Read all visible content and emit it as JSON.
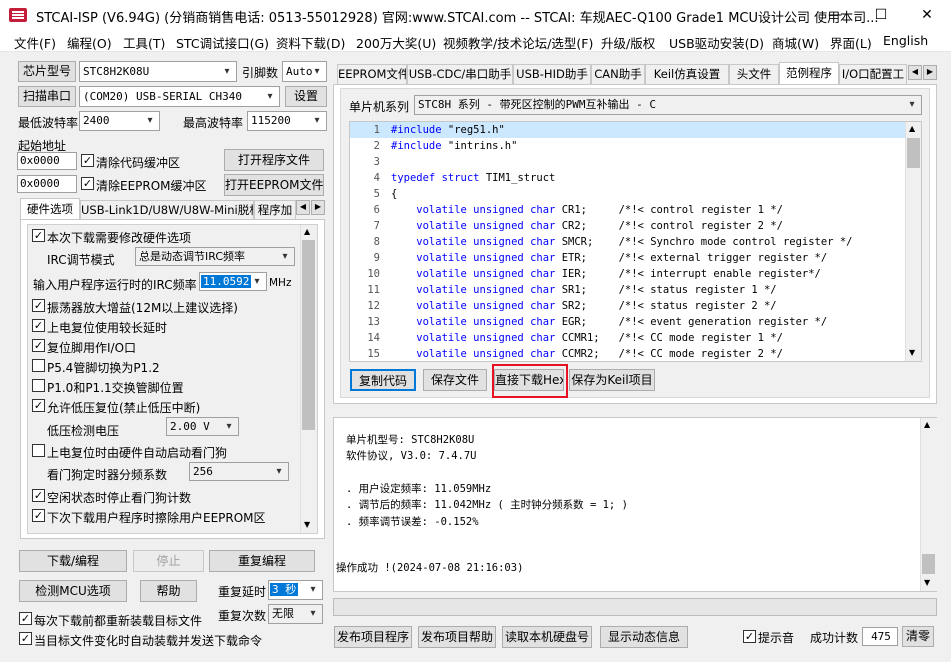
{
  "window": {
    "title": "STCAI-ISP (V6.94G) (分销商销售电话: 0513-55012928) 官网:www.STCAI.com  -- STCAI: 车规AEC-Q100 Grade1 MCU设计公司 使用本司...",
    "minimize": "—",
    "maximize": "☐",
    "close": "✕"
  },
  "menu": [
    "文件(F)",
    "编程(O)",
    "工具(T)",
    "STC调试接口(G)",
    "资料下载(D)",
    "200万大奖(U)",
    "视频教学/技术论坛/选型(F)",
    "升级/版权",
    "USB驱动安装(D)",
    "商城(W)",
    "界面(L)",
    "English"
  ],
  "left": {
    "chip_model_btn": "芯片型号",
    "chip_model": "STC8H2K08U",
    "pin_count_label": "引脚数",
    "pin_count": "Auto",
    "scan_port_btn": "扫描串口",
    "port": "(COM20) USB-SERIAL CH340",
    "settings_btn": "设置",
    "min_baud_label": "最低波特率",
    "min_baud": "2400",
    "max_baud_label": "最高波特率",
    "max_baud": "115200",
    "start_addr_label": "起始地址",
    "addr1": "0x0000",
    "clear_code_buffer": "清除代码缓冲区",
    "open_program_btn": "打开程序文件",
    "addr2": "0x0000",
    "clear_eeprom_buffer": "清除EEPROM缓冲区",
    "open_eeprom_btn": "打开EEPROM文件",
    "tabs": [
      "硬件选项",
      "USB-Link1D/U8W/U8W-Mini脱机",
      "程序加"
    ],
    "options": {
      "hw_change": "本次下载需要修改硬件选项",
      "irc_mode_label": "IRC调节模式",
      "irc_mode": "总是动态调节IRC频率",
      "irc_freq_label": "输入用户程序运行时的IRC频率",
      "irc_freq": "11.0592",
      "irc_unit": "MHz",
      "osc_gain": "振荡器放大增益(12M以上建议选择)",
      "por_delay": "上电复位使用较长延时",
      "reset_io": "复位脚用作I/O口",
      "p54_switch": "P5.4管脚切换为P1.2",
      "p10_swap": "P1.0和P1.1交换管脚位置",
      "lvr": "允许低压复位(禁止低压中断)",
      "lvd_label": "低压检测电压",
      "lvd_value": "2.00 V",
      "wdt_auto": "上电复位时由硬件自动启动看门狗",
      "wdt_prescale_label": "看门狗定时器分频系数",
      "wdt_prescale": "256",
      "wdt_idle": "空闲状态时停止看门狗计数",
      "erase_eeprom": "下次下载用户程序时擦除用户EEPROM区"
    },
    "download_btn": "下载/编程",
    "stop_btn": "停止",
    "reprogram_btn": "重复编程",
    "check_mcu_btn": "检测MCU选项",
    "help_btn": "帮助",
    "repeat_delay_label": "重复延时",
    "repeat_delay": "3 秒",
    "repeat_count_label": "重复次数",
    "repeat_count": "无限",
    "reload_before_download": "每次下载前都重新装载目标文件",
    "auto_load_on_change": "当目标文件变化时自动装载并发送下载命令"
  },
  "right": {
    "tabs": [
      "EEPROM文件",
      "USB-CDC/串口助手",
      "USB-HID助手",
      "CAN助手",
      "Keil仿真设置",
      "头文件",
      "范例程序",
      "I/O口配置工"
    ],
    "active_tab_index": 6,
    "mcu_series_label": "单片机系列",
    "mcu_series": "STC8H 系列 - 带死区控制的PWM互补输出 - C",
    "code_lines": [
      {
        "n": "1",
        "parts": [
          [
            "kw",
            "#include"
          ],
          [
            "str",
            " \"reg51.h\""
          ]
        ]
      },
      {
        "n": "2",
        "parts": [
          [
            "kw",
            "#include"
          ],
          [
            "str",
            " \"intrins.h\""
          ]
        ]
      },
      {
        "n": "3",
        "parts": []
      },
      {
        "n": "4",
        "parts": [
          [
            "kw",
            "typedef struct"
          ],
          [
            "str",
            " TIM1_struct"
          ]
        ]
      },
      {
        "n": "5",
        "parts": [
          [
            "str",
            "{"
          ]
        ]
      },
      {
        "n": "6",
        "parts": [
          [
            "kw",
            "    volatile unsigned char"
          ],
          [
            "str",
            " CR1;     "
          ],
          [
            "cm",
            "/*!< control register 1 */"
          ]
        ]
      },
      {
        "n": "7",
        "parts": [
          [
            "kw",
            "    volatile unsigned char"
          ],
          [
            "str",
            " CR2;     "
          ],
          [
            "cm",
            "/*!< control register 2 */"
          ]
        ]
      },
      {
        "n": "8",
        "parts": [
          [
            "kw",
            "    volatile unsigned char"
          ],
          [
            "str",
            " SMCR;    "
          ],
          [
            "cm",
            "/*!< Synchro mode control register */"
          ]
        ]
      },
      {
        "n": "9",
        "parts": [
          [
            "kw",
            "    volatile unsigned char"
          ],
          [
            "str",
            " ETR;     "
          ],
          [
            "cm",
            "/*!< external trigger register */"
          ]
        ]
      },
      {
        "n": "10",
        "parts": [
          [
            "kw",
            "    volatile unsigned char"
          ],
          [
            "str",
            " IER;     "
          ],
          [
            "cm",
            "/*!< interrupt enable register*/"
          ]
        ]
      },
      {
        "n": "11",
        "parts": [
          [
            "kw",
            "    volatile unsigned char"
          ],
          [
            "str",
            " SR1;     "
          ],
          [
            "cm",
            "/*!< status register 1 */"
          ]
        ]
      },
      {
        "n": "12",
        "parts": [
          [
            "kw",
            "    volatile unsigned char"
          ],
          [
            "str",
            " SR2;     "
          ],
          [
            "cm",
            "/*!< status register 2 */"
          ]
        ]
      },
      {
        "n": "13",
        "parts": [
          [
            "kw",
            "    volatile unsigned char"
          ],
          [
            "str",
            " EGR;     "
          ],
          [
            "cm",
            "/*!< event generation register */"
          ]
        ]
      },
      {
        "n": "14",
        "parts": [
          [
            "kw",
            "    volatile unsigned char"
          ],
          [
            "str",
            " CCMR1;   "
          ],
          [
            "cm",
            "/*!< CC mode register 1 */"
          ]
        ]
      },
      {
        "n": "15",
        "parts": [
          [
            "kw",
            "    volatile unsigned char"
          ],
          [
            "str",
            " CCMR2;   "
          ],
          [
            "cm",
            "/*!< CC mode register 2 */"
          ]
        ]
      }
    ],
    "copy_code_btn": "复制代码",
    "save_file_btn": "保存文件",
    "direct_download_hex_btn": "直接下载Hex",
    "save_keil_btn": "保存为Keil项目",
    "log_lines": [
      "单片机型号: STC8H2K08U",
      "软件协议, V3.0: 7.4.7U",
      "",
      ". 用户设定频率: 11.059MHz",
      ". 调节后的频率: 11.042MHz ( 主时钟分频系数 = 1; )",
      ". 频率调节误差: -0.152%",
      "",
      "",
      "操作成功 !(2024-07-08 21:16:03)"
    ],
    "publish_program_btn": "发布项目程序",
    "publish_help_btn": "发布项目帮助",
    "read_disk_btn": "读取本机硬盘号",
    "show_dynamic_btn": "显示动态信息",
    "beep_label": "提示音",
    "success_count_label": "成功计数",
    "success_count": "475",
    "clear_btn": "清零"
  },
  "colors": {
    "highlight_border": "#e81123",
    "selection": "#0078d7",
    "keyword": "#0000ff",
    "active_line": "#cce8ff"
  }
}
